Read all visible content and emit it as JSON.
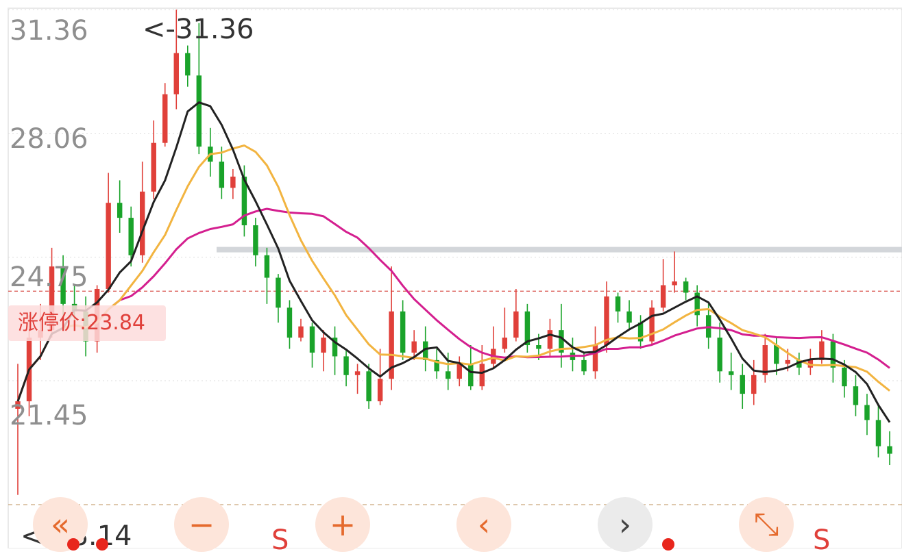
{
  "chart_data": {
    "type": "candlestick",
    "y_ticks": [
      "31.36",
      "28.06",
      "24.75",
      "21.45"
    ],
    "ylim": [
      18.14,
      31.36
    ],
    "high_label": "<-31.36",
    "low_label": "<-18.14",
    "limit_up_label": "涨停价:23.84",
    "limit_up_value": 23.84,
    "reference_level": 24.95,
    "colors": {
      "up": "#e0403a",
      "down": "#1aa32a",
      "ma5": "#222222",
      "ma10": "#f2b440",
      "ma20": "#d41f8f",
      "reference": "#d3d6da"
    },
    "candles": [
      [
        20.7,
        20.9,
        21.9,
        18.4
      ],
      [
        20.9,
        22.6,
        23.2,
        20.5
      ],
      [
        22.6,
        22.8,
        23.5,
        22.0
      ],
      [
        22.8,
        24.5,
        25.0,
        22.6
      ],
      [
        24.5,
        23.5,
        24.8,
        23.2
      ],
      [
        23.5,
        23.3,
        24.0,
        22.8
      ],
      [
        23.3,
        22.5,
        23.7,
        22.1
      ],
      [
        22.5,
        23.9,
        24.0,
        22.2
      ],
      [
        23.9,
        26.2,
        27.0,
        23.8
      ],
      [
        26.2,
        25.8,
        26.8,
        25.4
      ],
      [
        25.8,
        24.8,
        26.1,
        24.5
      ],
      [
        24.8,
        26.5,
        27.3,
        24.6
      ],
      [
        26.5,
        27.8,
        28.4,
        26.3
      ],
      [
        27.8,
        29.1,
        29.4,
        27.7
      ],
      [
        29.1,
        30.2,
        31.36,
        28.7
      ],
      [
        30.2,
        29.6,
        30.4,
        29.3
      ],
      [
        29.6,
        27.7,
        31.0,
        27.5
      ],
      [
        27.7,
        27.3,
        28.2,
        26.9
      ],
      [
        27.3,
        26.6,
        27.7,
        26.3
      ],
      [
        26.6,
        26.9,
        27.1,
        26.3
      ],
      [
        26.9,
        25.6,
        27.2,
        25.3
      ],
      [
        25.6,
        24.8,
        25.8,
        24.5
      ],
      [
        24.8,
        24.2,
        25.0,
        23.5
      ],
      [
        24.2,
        23.4,
        24.3,
        23.0
      ],
      [
        23.4,
        22.6,
        23.6,
        22.3
      ],
      [
        22.6,
        22.9,
        23.1,
        22.5
      ],
      [
        22.9,
        22.2,
        23.0,
        21.8
      ],
      [
        22.2,
        22.6,
        22.8,
        21.7
      ],
      [
        22.6,
        22.1,
        22.9,
        21.6
      ],
      [
        22.1,
        21.6,
        22.3,
        21.3
      ],
      [
        21.6,
        21.7,
        21.9,
        21.1
      ],
      [
        21.7,
        20.9,
        21.9,
        20.7
      ],
      [
        20.9,
        21.5,
        22.3,
        20.8
      ],
      [
        21.5,
        23.3,
        24.5,
        21.2
      ],
      [
        23.3,
        22.2,
        23.6,
        22.0
      ],
      [
        22.2,
        22.5,
        22.8,
        22.0
      ],
      [
        22.5,
        22.0,
        22.9,
        21.7
      ],
      [
        22.0,
        21.7,
        22.3,
        21.5
      ],
      [
        21.7,
        21.5,
        22.2,
        21.2
      ],
      [
        21.5,
        21.9,
        22.1,
        21.3
      ],
      [
        21.9,
        21.3,
        22.4,
        21.2
      ],
      [
        21.3,
        21.9,
        22.4,
        21.2
      ],
      [
        21.9,
        22.3,
        22.9,
        21.8
      ],
      [
        22.3,
        22.6,
        23.4,
        22.2
      ],
      [
        22.6,
        23.3,
        23.9,
        22.5
      ],
      [
        23.3,
        22.4,
        23.5,
        22.2
      ],
      [
        22.4,
        22.3,
        22.7,
        22.0
      ],
      [
        22.3,
        22.8,
        23.1,
        22.1
      ],
      [
        22.8,
        22.2,
        23.5,
        21.8
      ],
      [
        22.2,
        22.0,
        22.6,
        21.7
      ],
      [
        22.0,
        21.7,
        22.2,
        21.6
      ],
      [
        21.7,
        22.4,
        22.9,
        21.5
      ],
      [
        22.4,
        23.7,
        24.1,
        22.2
      ],
      [
        23.7,
        23.3,
        23.8,
        23.0
      ],
      [
        23.3,
        23.0,
        23.6,
        22.8
      ],
      [
        23.0,
        22.5,
        23.2,
        22.3
      ],
      [
        22.5,
        23.4,
        23.6,
        22.4
      ],
      [
        23.4,
        24.0,
        24.7,
        23.3
      ],
      [
        24.0,
        24.1,
        24.9,
        23.8
      ],
      [
        24.1,
        23.8,
        24.2,
        23.6
      ],
      [
        23.8,
        23.2,
        24.0,
        22.9
      ],
      [
        23.2,
        22.6,
        23.5,
        22.3
      ],
      [
        22.6,
        21.7,
        23.0,
        21.4
      ],
      [
        21.7,
        21.6,
        22.2,
        21.2
      ],
      [
        21.6,
        21.1,
        21.9,
        20.7
      ],
      [
        21.1,
        21.6,
        22.0,
        20.8
      ],
      [
        21.6,
        22.4,
        22.7,
        21.4
      ],
      [
        22.4,
        21.9,
        22.6,
        21.6
      ],
      [
        21.9,
        22.0,
        22.3,
        21.7
      ],
      [
        22.0,
        21.8,
        22.2,
        21.6
      ],
      [
        21.8,
        22.0,
        22.3,
        21.6
      ],
      [
        22.0,
        22.5,
        22.8,
        21.9
      ],
      [
        22.5,
        21.8,
        22.7,
        21.4
      ],
      [
        21.8,
        21.3,
        22.0,
        21.0
      ],
      [
        21.3,
        20.8,
        21.6,
        20.5
      ],
      [
        20.8,
        20.4,
        21.1,
        20.0
      ],
      [
        20.4,
        19.7,
        20.8,
        19.4
      ],
      [
        19.7,
        19.5,
        20.1,
        19.2
      ]
    ]
  },
  "controls": {
    "rewind_icon": "«",
    "zoom_out_icon": "−",
    "zoom_in_icon": "+",
    "prev_icon": "‹",
    "next_icon": "›",
    "fullscreen_icon": "⤡",
    "sell_mark_1": "S",
    "sell_mark_2": "S"
  }
}
